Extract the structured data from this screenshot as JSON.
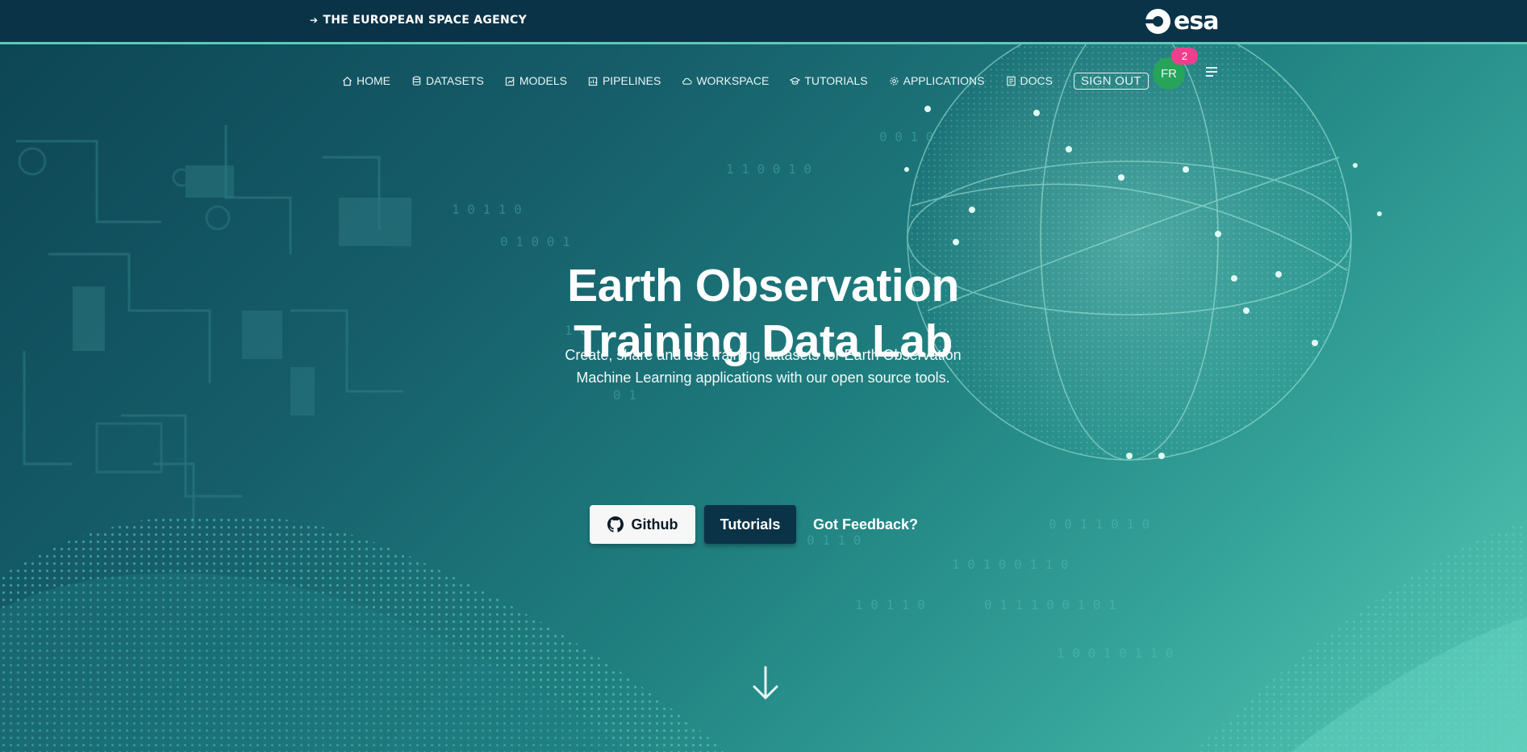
{
  "header": {
    "agency_text": "THE EUROPEAN SPACE AGENCY",
    "logo_text": "esa"
  },
  "nav": {
    "items": [
      {
        "label": "HOME",
        "icon": "home-icon"
      },
      {
        "label": "DATASETS",
        "icon": "database-icon"
      },
      {
        "label": "MODELS",
        "icon": "models-icon"
      },
      {
        "label": "PIPELINES",
        "icon": "pipelines-icon"
      },
      {
        "label": "WORKSPACE",
        "icon": "cloud-icon"
      },
      {
        "label": "TUTORIALS",
        "icon": "graduation-cap-icon"
      },
      {
        "label": "APPLICATIONS",
        "icon": "gear-icon"
      },
      {
        "label": "DOCS",
        "icon": "book-icon"
      }
    ],
    "sign_out": "SIGN OUT",
    "avatar_initials": "FR",
    "notification_count": "2"
  },
  "hero": {
    "title_line1": "Earth Observation",
    "title_line2": "Training Data Lab",
    "subtitle_line1": "Create, share and use training datasets for Earth Observation",
    "subtitle_line2": "Machine Learning applications with our open source tools.",
    "github_label": "Github",
    "tutorials_label": "Tutorials",
    "feedback_label": "Got Feedback?"
  },
  "colors": {
    "header_bg": "#0b3347",
    "accent_line": "#5ec9b6",
    "avatar_bg": "#27a35a",
    "badge_bg": "#ee3f8f"
  }
}
